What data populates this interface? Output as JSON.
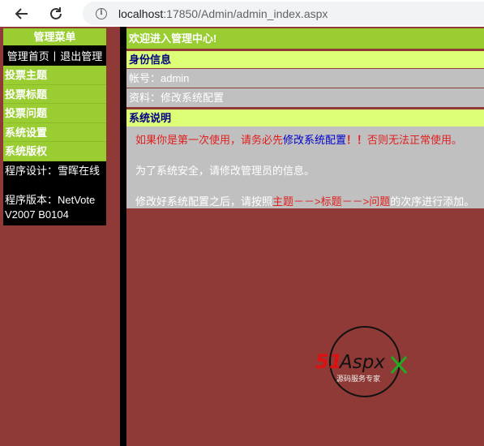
{
  "browser": {
    "url_host": "localhost",
    "url_rest": ":17850/Admin/admin_index.aspx"
  },
  "sidebar": {
    "title": "管理菜单",
    "links": [
      "管理首页",
      "|",
      "退出管理"
    ],
    "items": [
      "投票主题",
      "投票标题",
      "投票问题",
      "系统设置",
      "系统版权"
    ],
    "designer": "程序设计：雪晖在线",
    "version": "程序版本：NetVote V2007 B0104"
  },
  "main": {
    "welcome": "欢迎进入管理中心!",
    "identity_title": "身份信息",
    "account": "帐号：admin",
    "profile": "资料：修改系统配置",
    "system_title": "系统说明",
    "desc1_a": "如果你是第一次使用，请务必先",
    "desc1_link": "修改系统配置",
    "desc1_b": "！！",
    "desc1_c": "否则无法正常使用。",
    "desc2": "为了系统安全，请修改管理员的信息。",
    "desc3_a": "修改好系统配置之后，请按照",
    "desc3_b": "主题－－>标题－－>问题",
    "desc3_c": "的次序进行添加。"
  },
  "logo": {
    "brand": "51Aspx",
    "tagline": "源码服务专家"
  },
  "colors": {
    "background": "#8f3a36",
    "menu_green": "#9acd32",
    "section_yellow": "#ddff77",
    "panel_grey": "#c0c0c0",
    "accent_red": "#e02020"
  }
}
